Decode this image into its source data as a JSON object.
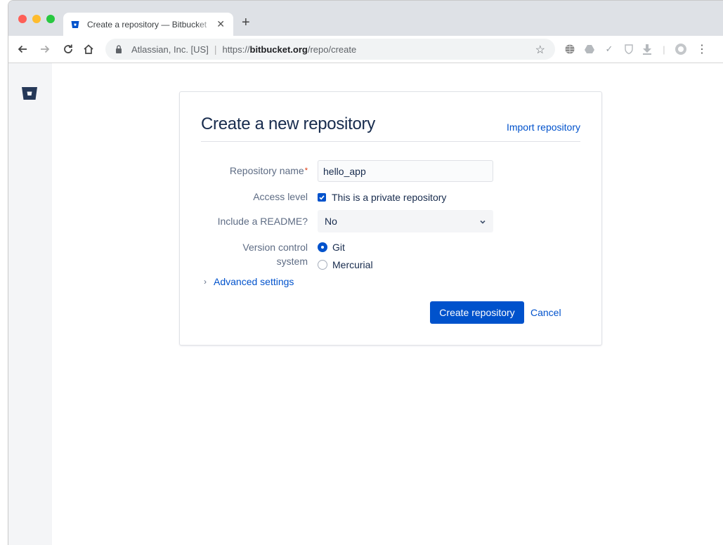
{
  "browser": {
    "tab_title": "Create a repository — Bitbucket",
    "tab_close": "✕",
    "new_tab": "+",
    "org": "Atlassian, Inc. [US]",
    "separator": "|",
    "url_scheme": "https://",
    "url_host": "bitbucket.org",
    "url_path": "/repo/create",
    "traffic_lights": [
      "#fe5f57",
      "#febc2e",
      "#28c840"
    ]
  },
  "form": {
    "title": "Create a new repository",
    "import_link": "Import repository",
    "repo_name_label": "Repository name",
    "required_mark": "*",
    "repo_name_value": "hello_app",
    "access_label": "Access level",
    "private_label": "This is a private repository",
    "private_checked": true,
    "readme_label": "Include a README?",
    "readme_value": "No",
    "vcs_label_line1": "Version control",
    "vcs_label_line2": "system",
    "vcs_options": [
      {
        "label": "Git",
        "selected": true
      },
      {
        "label": "Mercurial",
        "selected": false
      }
    ],
    "advanced_chevron": "›",
    "advanced_label": "Advanced settings",
    "create_button": "Create repository",
    "cancel_link": "Cancel"
  },
  "colors": {
    "accent": "#0052cc",
    "title_text": "#172b4d",
    "label_text": "#5e6c84",
    "required": "#de350b",
    "sidebar_bg": "#f4f5f7",
    "logo": "#253858"
  }
}
